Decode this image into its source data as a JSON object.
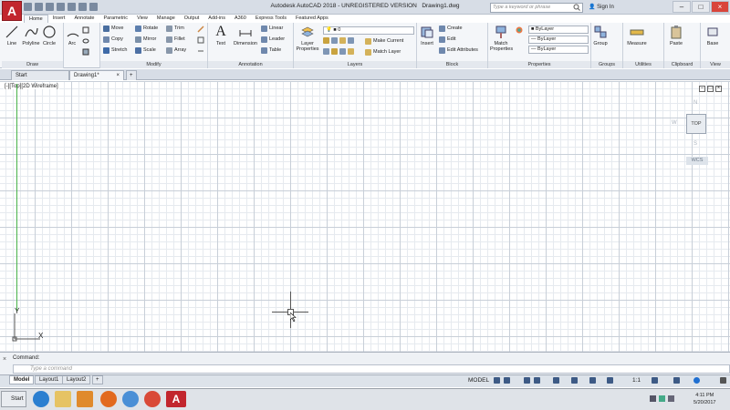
{
  "window": {
    "title_app": "Autodesk AutoCAD 2018 - UNREGISTERED VERSION",
    "title_file": "Drawing1.dwg",
    "search_placeholder": "Type a keyword or phrase",
    "sign_in": "Sign In",
    "logo": "A"
  },
  "ribbon_tabs": [
    "Home",
    "Insert",
    "Annotate",
    "Parametric",
    "View",
    "Manage",
    "Output",
    "Add-ins",
    "A360",
    "Express Tools",
    "Featured Apps"
  ],
  "panels": {
    "draw": {
      "title": "Draw",
      "line": "Line",
      "polyline": "Polyline",
      "circle": "Circle",
      "arc": "Arc"
    },
    "modify": {
      "title": "Modify",
      "move": "Move",
      "copy": "Copy",
      "stretch": "Stretch",
      "rotate": "Rotate",
      "mirror": "Mirror",
      "scale": "Scale",
      "trim": "Trim",
      "fillet": "Fillet",
      "array": "Array"
    },
    "annotation": {
      "title": "Annotation",
      "text": "Text",
      "dimension": "Dimension",
      "linear": "Linear",
      "leader": "Leader",
      "table": "Table"
    },
    "layers": {
      "title": "Layers",
      "properties": "Layer Properties",
      "current_layer": "0",
      "make_current": "Make Current",
      "match_layer": "Match Layer"
    },
    "block": {
      "title": "Block",
      "insert": "Insert",
      "create": "Create",
      "edit": "Edit",
      "edit_attributes": "Edit Attributes"
    },
    "properties": {
      "title": "Properties",
      "match": "Match Properties",
      "color": "ByLayer",
      "linetype": "ByLayer",
      "lineweight": "ByLayer"
    },
    "groups": {
      "title": "Groups",
      "group": "Group"
    },
    "utilities": {
      "title": "Utilities",
      "measure": "Measure"
    },
    "clipboard": {
      "title": "Clipboard",
      "paste": "Paste"
    },
    "view": {
      "title": "View",
      "base": "Base"
    }
  },
  "file_tabs": {
    "start": "Start",
    "drawing": "Drawing1*",
    "add": "+"
  },
  "viewport": {
    "label": "[-][Top][2D Wireframe]",
    "cube_top": "TOP",
    "compass_n": "N",
    "compass_w": "W",
    "compass_s": "S",
    "wcs": "WCS",
    "ucs_y": "Y",
    "ucs_x": "X"
  },
  "command": {
    "history": "Command:",
    "placeholder": "Type a command"
  },
  "layout_tabs": [
    "Model",
    "Layout1",
    "Layout2"
  ],
  "status": {
    "model": "MODEL",
    "scale": "1:1"
  },
  "taskbar": {
    "start": "Start",
    "time": "4:11 PM",
    "date": "5/20/2017"
  },
  "colors": {
    "accent": "#c2262e",
    "ucs_green": "#49b34a",
    "ribbon_bg": "#f4f6f9"
  }
}
